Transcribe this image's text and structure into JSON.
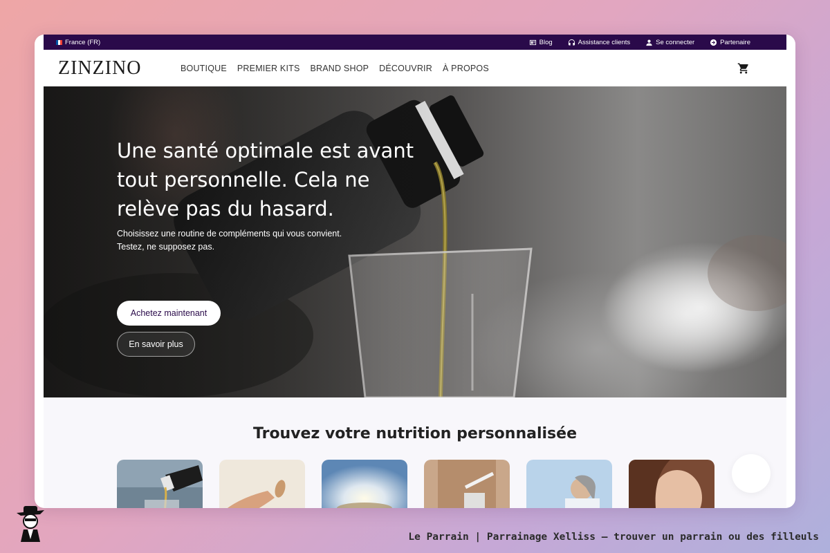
{
  "topbar": {
    "region": "France (FR)",
    "links": [
      {
        "label": "Blog",
        "icon": "blog-icon"
      },
      {
        "label": "Assistance clients",
        "icon": "headset-icon"
      },
      {
        "label": "Se connecter",
        "icon": "user-icon"
      },
      {
        "label": "Partenaire",
        "icon": "arrow-circle-icon"
      }
    ]
  },
  "nav": {
    "logo": "ZINZINO",
    "items": [
      "BOUTIQUE",
      "PREMIER KITS",
      "BRAND SHOP",
      "DÉCOUVRIR",
      "À PROPOS"
    ],
    "cart_icon": "cart-icon"
  },
  "hero": {
    "title": "Une santé optimale est avant tout personnelle. Cela ne relève pas du hasard.",
    "subtitle_line1": "Choisissez une routine de compléments qui vous convient.",
    "subtitle_line2": "Testez, ne supposez pas.",
    "primary_button": "Achetez maintenant",
    "secondary_button": "En savoir plus"
  },
  "section": {
    "title": "Trouvez votre nutrition personnalisée",
    "cards": [
      "oil-pour-image",
      "capsule-image",
      "sun-image",
      "powder-drink-image",
      "woman-drinking-image",
      "skin-care-image"
    ]
  },
  "footer": {
    "caption": "Le Parrain | Parrainage Xelliss — trouver un parrain ou des filleuls"
  },
  "colors": {
    "topbar_bg": "#2a0a4a",
    "accent": "#2a0a4a",
    "background_gradient_start": "#eea6a6",
    "background_gradient_end": "#aeb0dc"
  }
}
